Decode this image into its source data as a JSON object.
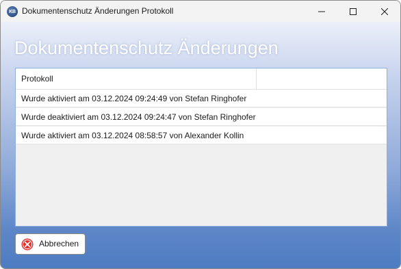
{
  "window": {
    "title": "Dokumentenschutz Änderungen Protokoll",
    "app_icon_text": "KB"
  },
  "heading": "Dokumentenschutz Änderungen",
  "list": {
    "column_header": "Protokoll",
    "rows": [
      "Wurde aktiviert am 03.12.2024 09:24:49 von Stefan Ringhofer",
      "Wurde deaktiviert am 03.12.2024 09:24:47 von Stefan Ringhofer",
      "Wurde aktiviert am 03.12.2024 08:58:57 von Alexander Kollin"
    ]
  },
  "buttons": {
    "cancel_label": "Abbrechen"
  },
  "icons": {
    "minimize": "minimize-icon",
    "maximize": "maximize-icon",
    "close": "close-icon",
    "cancel": "cancel-circle-icon"
  },
  "colors": {
    "accent": "#4e7cc2",
    "cancel_icon": "#e0312f"
  }
}
